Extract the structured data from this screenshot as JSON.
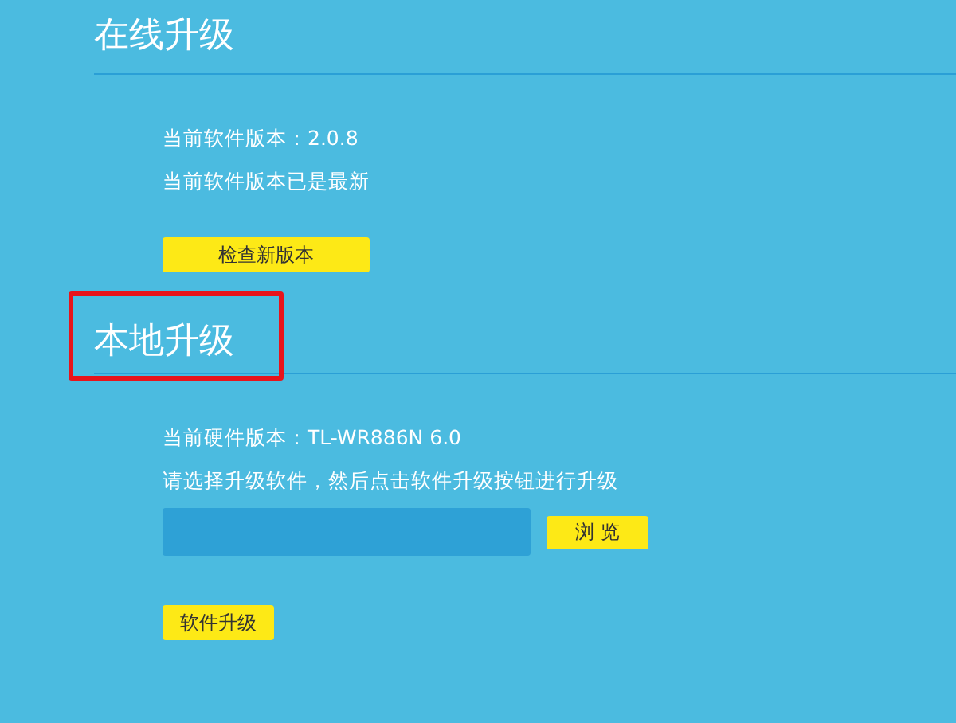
{
  "sections": [
    {
      "title": "在线升级",
      "highlighted": false,
      "lines": [
        "当前软件版本：2.0.8",
        "当前软件版本已是最新"
      ],
      "button": "检查新版本"
    },
    {
      "title": "本地升级",
      "highlighted": true,
      "lines": [
        "当前硬件版本：TL-WR886N 6.0",
        "请选择升级软件，然后点击软件升级按钮进行升级"
      ],
      "file_field": {
        "browse_button": "浏 览"
      },
      "button": "软件升级"
    }
  ]
}
